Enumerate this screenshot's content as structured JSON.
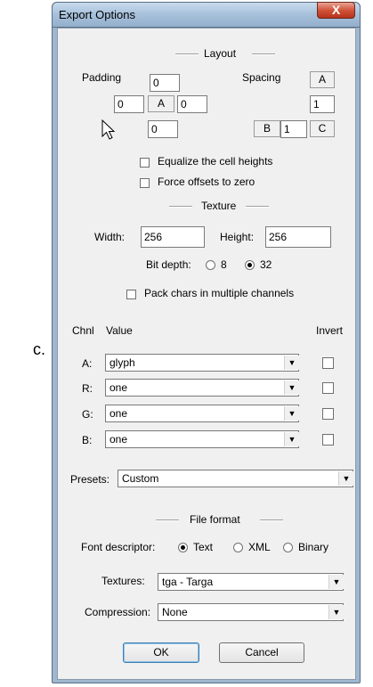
{
  "caption": "c.",
  "window": {
    "title": "Export Options",
    "close_glyph": "X"
  },
  "layout": {
    "title": "Layout",
    "padding_label": "Padding",
    "spacing_label": "Spacing",
    "padding_top": "0",
    "padding_left": "0",
    "padding_center": "A",
    "padding_right": "0",
    "padding_bottom": "0",
    "spacing_a": "A",
    "spacing_vertical": "1",
    "spacing_b": "B",
    "spacing_horizontal": "1",
    "spacing_c": "C",
    "equalize_label": "Equalize the cell heights",
    "equalize_checked": false,
    "force_offsets_label": "Force offsets to zero",
    "force_offsets_checked": false
  },
  "texture": {
    "title": "Texture",
    "width_label": "Width:",
    "width_value": "256",
    "height_label": "Height:",
    "height_value": "256",
    "bitdepth_label": "Bit depth:",
    "bit8_label": "8",
    "bit32_label": "32",
    "bitdepth_selected": "32",
    "pack_label": "Pack chars in multiple channels",
    "pack_checked": false
  },
  "channels": {
    "chnl_header": "Chnl",
    "value_header": "Value",
    "invert_header": "Invert",
    "rows": [
      {
        "label": "A:",
        "value": "glyph",
        "invert": false
      },
      {
        "label": "R:",
        "value": "one",
        "invert": false
      },
      {
        "label": "G:",
        "value": "one",
        "invert": false
      },
      {
        "label": "B:",
        "value": "one",
        "invert": false
      }
    ],
    "presets_label": "Presets:",
    "presets_value": "Custom"
  },
  "file_format": {
    "title": "File format",
    "descriptor_label": "Font descriptor:",
    "text_label": "Text",
    "xml_label": "XML",
    "binary_label": "Binary",
    "descriptor_selected": "Text",
    "textures_label": "Textures:",
    "textures_value": "tga - Targa",
    "compression_label": "Compression:",
    "compression_value": "None"
  },
  "buttons": {
    "ok": "OK",
    "cancel": "Cancel"
  },
  "icons": {
    "dropdown": "chevron-down-icon",
    "cursor": "mouse-pointer-icon"
  }
}
